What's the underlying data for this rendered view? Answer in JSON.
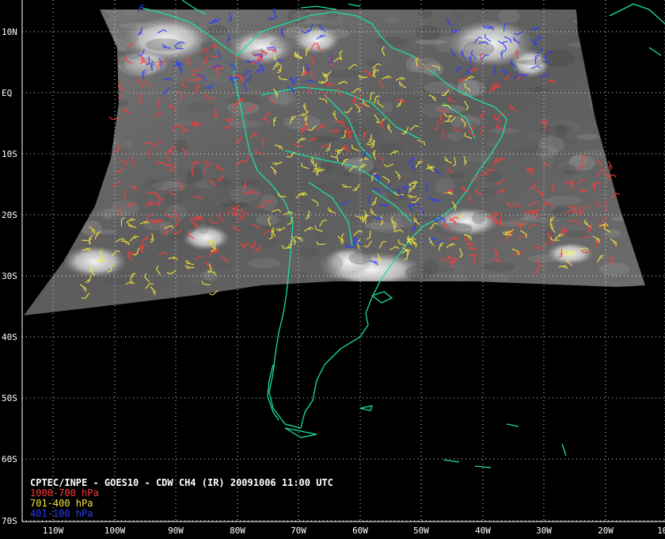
{
  "title": "CPTEC/INPE - GOES10 - CDW CH4 (IR) 20091006 11:00 UTC",
  "legend": [
    {
      "label": "1000-700 hPa",
      "color": "#ff3b3b"
    },
    {
      "label": "701-400 hPa",
      "color": "#f2e43a"
    },
    {
      "label": "401-100 hPa",
      "color": "#2a3bff"
    }
  ],
  "map": {
    "lat_labels": [
      "10N",
      "EQ",
      "10S",
      "20S",
      "30S",
      "40S",
      "50S",
      "60S",
      "70S"
    ],
    "lon_labels": [
      "110W",
      "100W",
      "90W",
      "80W",
      "70W",
      "60W",
      "50W",
      "40W",
      "30W",
      "20W",
      "10W"
    ],
    "coastline_color": "#19e0a0",
    "grid_color": "#ffffff"
  }
}
